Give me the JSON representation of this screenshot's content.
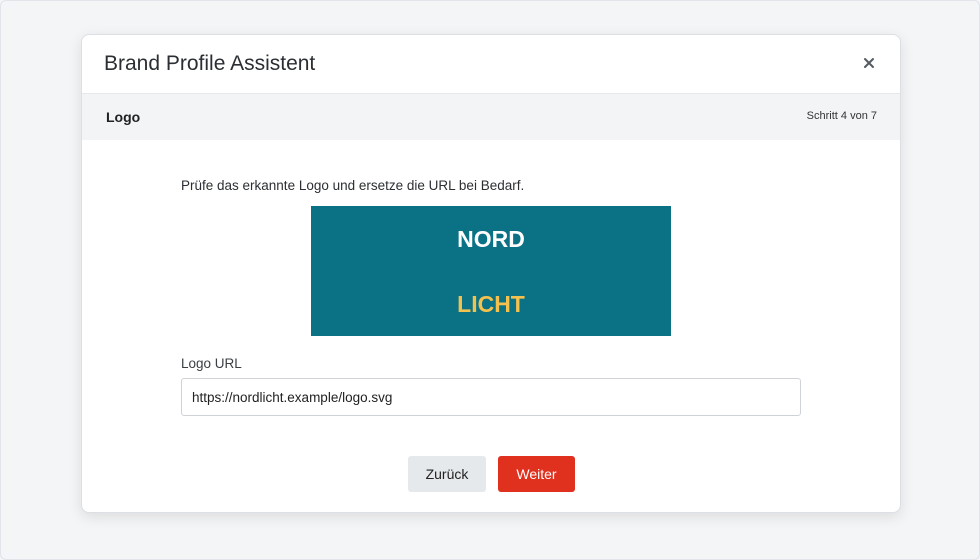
{
  "dialog": {
    "title": "Brand Profile Assistent"
  },
  "step": {
    "title": "Logo",
    "counter": "Schritt 4 von 7"
  },
  "content": {
    "instruction": "Prüfe das erkannte Logo und ersetze die URL bei Bedarf.",
    "logo": {
      "line1": "NORD",
      "line2": "LICHT",
      "background_color": "#0b7285",
      "line1_color": "#ffffff",
      "line2_color": "#f2c14e"
    },
    "url_field": {
      "label": "Logo URL",
      "value": "https://nordlicht.example/logo.svg"
    }
  },
  "actions": {
    "back_label": "Zurück",
    "next_label": "Weiter",
    "next_color": "#e0301e"
  },
  "icons": {
    "close": "close-icon"
  }
}
